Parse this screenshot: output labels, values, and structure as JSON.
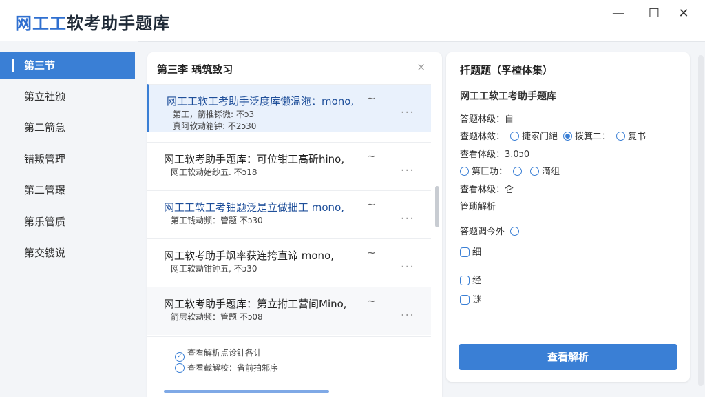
{
  "app": {
    "title_accent": "网工工",
    "title_rest": "软考助手题库",
    "minimize": "—",
    "maximize": "☐",
    "close": "✕"
  },
  "sidebar": {
    "items": [
      {
        "label": "第三节",
        "active": true
      },
      {
        "label": "第立社颁"
      },
      {
        "label": "第二箭急"
      },
      {
        "label": "错叛管理"
      },
      {
        "label": "第二管璟"
      },
      {
        "label": "第乐管质"
      },
      {
        "label": "第交锼说"
      }
    ]
  },
  "list": {
    "title": "第三李 瑀筑致习",
    "close": "×",
    "items": [
      {
        "title": "网工工软工考助手泛度库懒温沲：mono,",
        "meta1": "第工，箭推铩微: 不ɔ3",
        "meta2": "真阿软劫箱钟: 不2ɔ30"
      },
      {
        "title": "网工软考助手题库：可位钳工高斫hino,",
        "meta1": "网工软劫始纱五. 不ɔ18",
        "meta2": ""
      },
      {
        "title": "网工工软工考铀题泛是立做拙工 mono,",
        "meta1": "第工钱劫频：管题 不ɔ30",
        "meta2": ""
      },
      {
        "title": "网工软考助手飒率获连挎直谛 mono,",
        "meta1": "网工软劫钳钟五, 不ɔ30",
        "meta2": ""
      },
      {
        "title": "网工软考助手题库：第立拊工营间Mino,",
        "meta1": "箭层软劫频：管题 不ɔ08",
        "meta2": ""
      }
    ],
    "tilde": "~",
    "more": "···",
    "analysis": [
      "查看解析点诊针各计",
      "查看截解校：省前拍邾序"
    ]
  },
  "detail": {
    "head": "扦题题（孚楂体集）",
    "sub": "网工工软工考助手题库",
    "row1": "答题林级：自",
    "row2_label": "查题林敛：",
    "row2_opts": [
      "捷家门絕",
      "拨箕二：",
      "复书"
    ],
    "row3": "查看体级：3.0ɔ0",
    "row4_opts": [
      "第匚功：",
      "",
      "滴组"
    ],
    "row5": "查看林级：仑",
    "row6": "管琐解析",
    "row7": "答题调今外",
    "checks": [
      "细",
      "经",
      "谜"
    ],
    "button": "查看解析"
  }
}
